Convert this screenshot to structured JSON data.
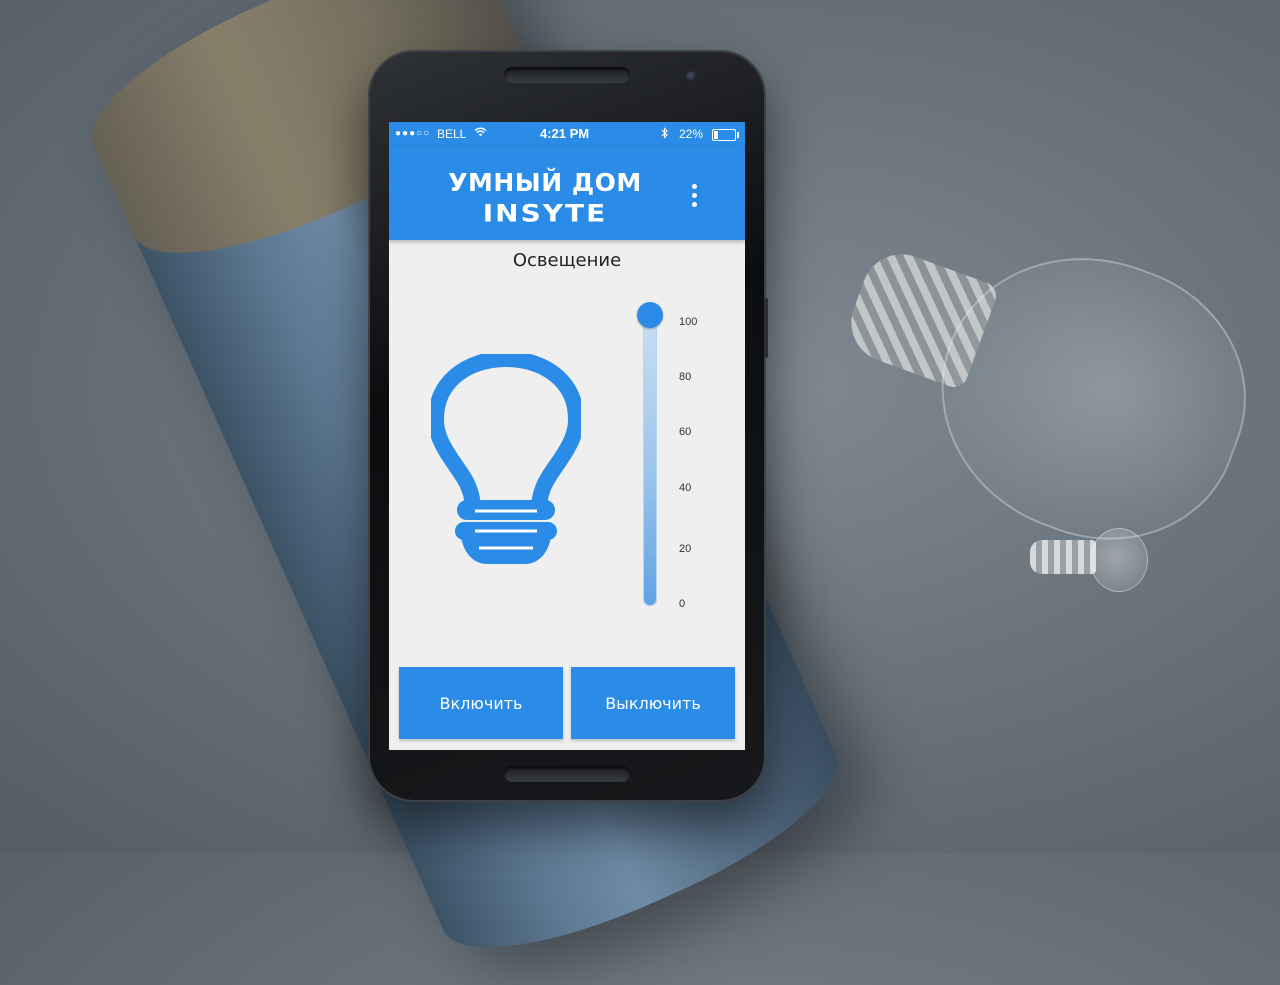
{
  "status_bar": {
    "signal": "●●●○○",
    "carrier": "BELL",
    "wifi_icon": "wifi-icon",
    "time": "4:21 PM",
    "bluetooth_icon": "bluetooth-icon",
    "battery_text": "22%",
    "battery_level": 0.22
  },
  "app_bar": {
    "logo_line1": "УМНЫЙ ДОМ",
    "logo_line2": "INSYTE",
    "menu_icon": "more-vert-icon"
  },
  "main": {
    "title": "Освещение",
    "bulb_icon": "light-bulb-icon",
    "slider": {
      "value": 100,
      "min": 0,
      "max": 100,
      "ticks": [
        "100",
        "80",
        "60",
        "40",
        "20",
        "0"
      ]
    },
    "buttons": {
      "on_label": "Включить",
      "off_label": "Выключить"
    }
  },
  "colors": {
    "accent": "#2a8ce6",
    "screen_bg": "#efefef"
  }
}
